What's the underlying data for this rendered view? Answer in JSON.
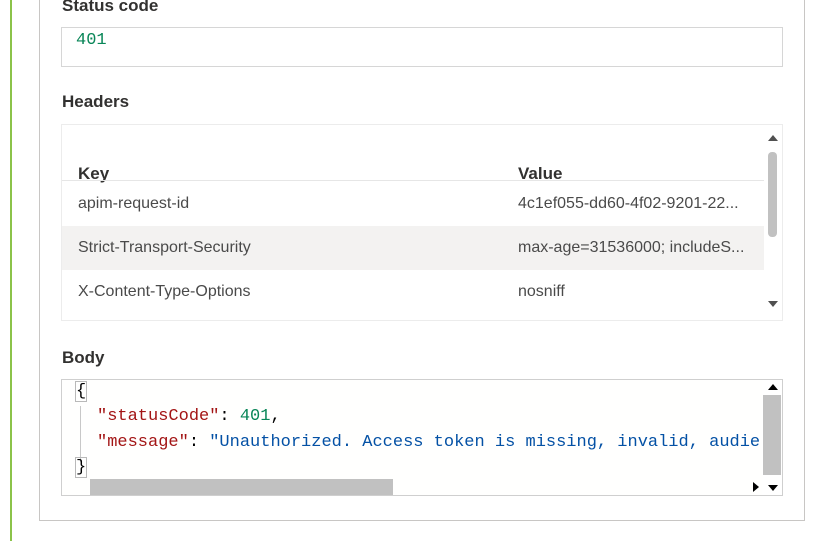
{
  "status": {
    "label": "Status code",
    "value": "401"
  },
  "headers": {
    "label": "Headers",
    "columns": [
      "Key",
      "Value"
    ],
    "rows": [
      {
        "key": "apim-request-id",
        "value": "4c1ef055-dd60-4f02-9201-22..."
      },
      {
        "key": "Strict-Transport-Security",
        "value": "max-age=31536000; includeS..."
      },
      {
        "key": "X-Content-Type-Options",
        "value": "nosniff"
      }
    ]
  },
  "body": {
    "label": "Body",
    "open_brace": "{",
    "close_brace": "}",
    "line1_key": "\"statusCode\"",
    "line1_sep": ": ",
    "line1_value": "401",
    "line1_end": ",",
    "line2_key": "\"message\"",
    "line2_sep": ": ",
    "line2_value": "\"Unauthorized. Access token is missing, invalid, audie"
  },
  "colors": {
    "key": "#a31515",
    "number": "#098658",
    "string": "#0451a5",
    "accent": "#8bc34a"
  }
}
